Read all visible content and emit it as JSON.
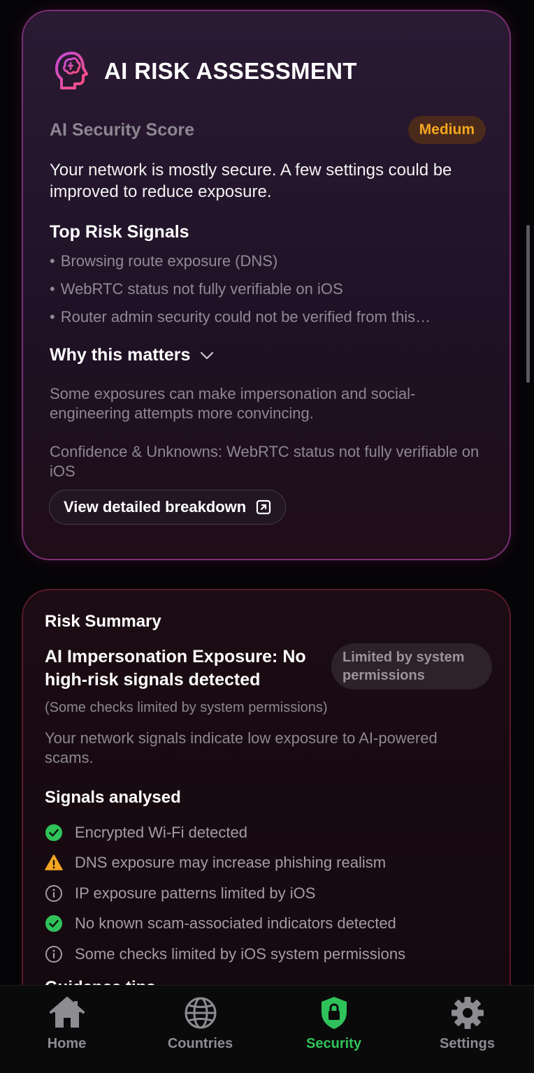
{
  "ai_card": {
    "title": "AI RISK ASSESSMENT",
    "score_label": "AI Security Score",
    "score_badge": "Medium",
    "summary": "Your network is mostly secure. A few settings could be improved to reduce exposure.",
    "signals_title": "Top Risk Signals",
    "signals": [
      "Browsing route exposure (DNS)",
      "WebRTC status not fully verifiable on iOS",
      "Router admin security could not be verified from this…"
    ],
    "bullet": "•",
    "why_title": "Why this matters",
    "why_text": "Some exposures can make impersonation and social-engineering attempts more convincing.",
    "confidence": "Confidence & Unknowns: WebRTC status not fully verifiable on iOS",
    "breakdown_button": "View detailed breakdown"
  },
  "risk_card": {
    "title": "Risk Summary",
    "heading": "AI Impersonation Exposure: No high-risk signals detected",
    "limited_badge": "Limited by system permissions",
    "note": "(Some checks limited by system permissions)",
    "description": "Your network signals indicate low exposure to AI-powered scams.",
    "analysed_title": "Signals analysed",
    "analysed": [
      {
        "icon": "check-circle-icon",
        "text": "Encrypted Wi-Fi detected"
      },
      {
        "icon": "warning-icon",
        "text": "DNS exposure may increase phishing realism"
      },
      {
        "icon": "info-icon",
        "text": "IP exposure patterns limited by iOS"
      },
      {
        "icon": "check-circle-icon",
        "text": "No known scam-associated indicators detected"
      },
      {
        "icon": "info-icon",
        "text": "Some checks limited by iOS system permissions"
      }
    ],
    "guidance_title": "Guidance tips"
  },
  "tabs": [
    {
      "label": "Home",
      "icon": "home-icon",
      "active": false
    },
    {
      "label": "Countries",
      "icon": "globe-icon",
      "active": false
    },
    {
      "label": "Security",
      "icon": "shield-lock-icon",
      "active": true
    },
    {
      "label": "Settings",
      "icon": "gear-icon",
      "active": false
    }
  ],
  "colors": {
    "accent_green": "#2fc25a",
    "badge_orange": "#f5a623",
    "warning_yellow": "#f5a623",
    "success_green": "#2fc25a"
  }
}
